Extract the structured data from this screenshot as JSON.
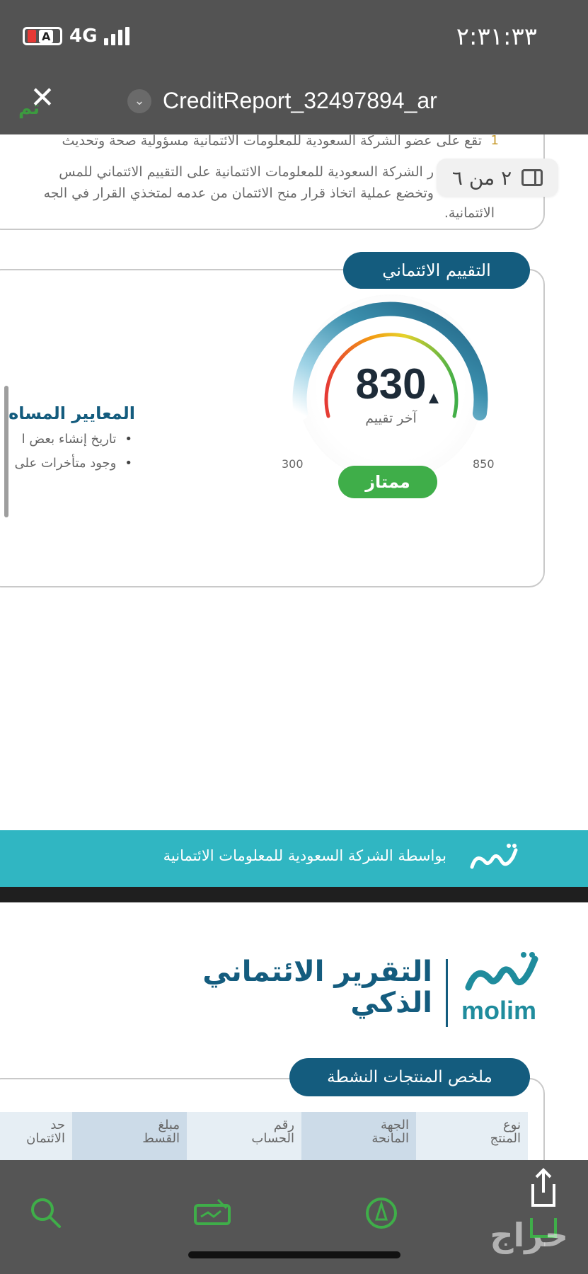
{
  "status": {
    "time": "٢:٣١:٣٣",
    "battery_label": "A",
    "network": "4G"
  },
  "header": {
    "title": "CreditReport_32497894_ar",
    "close_peek": "تم"
  },
  "page_indicator": "٢ من ٦",
  "notes": {
    "num": "1",
    "line1": "تقع على عضو الشركة السعودية للمعلومات الائتمانية مسؤولية صحة وتحديث",
    "line2": "ر الشركة السعودية للمعلومات الائتمانية على التقييم الائتماني للمس",
    "line3": "وتخضع عملية اتخاذ قرار منح الائتمان من عدمه لمتخذي القرار في الجه",
    "line4": "الائتمانية."
  },
  "score": {
    "pill": "التقييم الائتماني",
    "value": "830",
    "sub": "آخر تقييم",
    "min": "300",
    "max": "850",
    "rating": "ممتاز",
    "score_value": 830,
    "score_min": 300,
    "score_max": 850
  },
  "criteria": {
    "title": "المعايير المساه",
    "items": [
      "تاريخ إنشاء بعض ا",
      "وجود متأخرات على"
    ]
  },
  "band": {
    "text": "بواسطة الشركة السعودية للمعلومات الائتمانية"
  },
  "report": {
    "title_line1": "التقرير الائتماني",
    "title_line2": "الذكي",
    "brand": "molim"
  },
  "summary": {
    "pill": "ملخص المنتجات النشطة",
    "columns": [
      [
        "نوع",
        "المنتج"
      ],
      [
        "الجهة",
        "المانحة"
      ],
      [
        "رقم",
        "الحساب"
      ],
      [
        "مبلغ",
        "القسط"
      ],
      [
        "حد",
        "الائتمان"
      ]
    ]
  },
  "watermark": "حراج",
  "colors": {
    "brand_navy": "#145c7e",
    "teal": "#30b6c2",
    "excellent_green": "#3fae49",
    "toolbar": "#555555"
  },
  "icons": [
    "search-icon",
    "signature-icon",
    "markup-icon",
    "share-icon",
    "close-icon",
    "chevron-down-icon",
    "sidebar-icon"
  ]
}
